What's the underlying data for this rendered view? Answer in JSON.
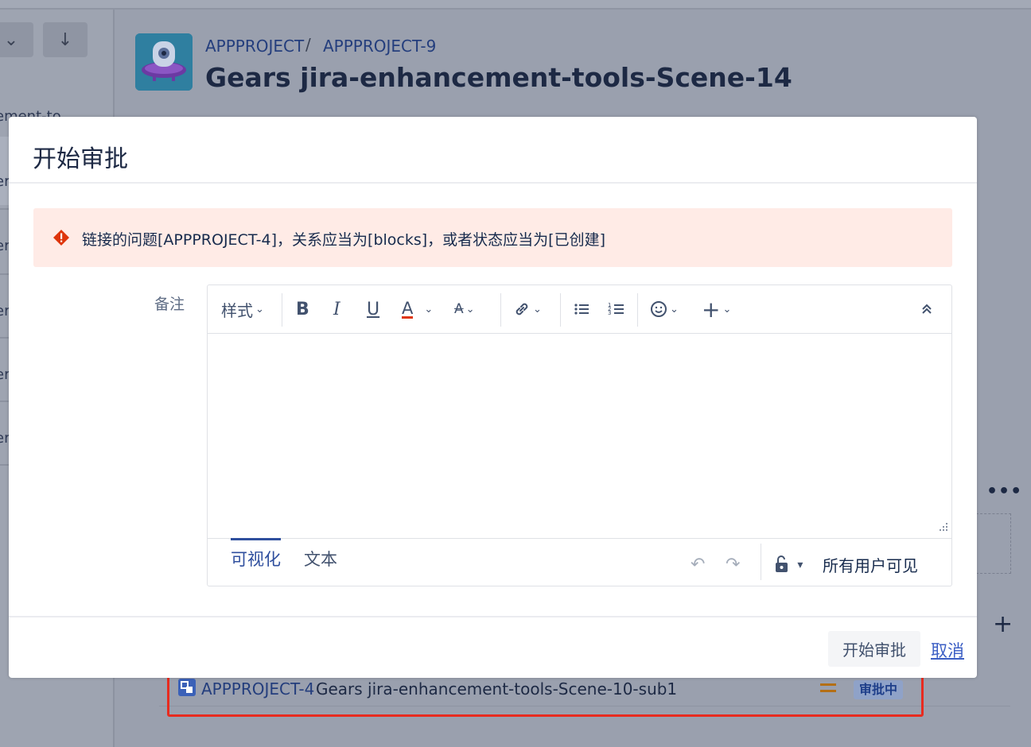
{
  "page": {
    "breadcrumb": {
      "project": "APPPROJECT",
      "separator": "/",
      "issue": "APPPROJECT-9"
    },
    "title": "Gears jira-enhancement-tools-Scene-14",
    "side_snippet": "ement-to",
    "side_letters": [
      "er",
      "er",
      "er",
      "er",
      "er"
    ]
  },
  "linked_issue": {
    "key": "APPPROJECT-4",
    "summary": "Gears jira-enhancement-tools-Scene-10-sub1",
    "status": "审批中",
    "priority_icon": "medium-priority-icon"
  },
  "dialog": {
    "title": "开始审批",
    "error_message": "链接的问题[APPPROJECT-4]，关系应当为[blocks]，或者状态应当为[已创建]",
    "note_label": "备注",
    "toolbar": {
      "style_label": "样式",
      "bold": "B",
      "italic": "I",
      "underline": "U",
      "text_color": "A",
      "more_format": "A",
      "plus": "+"
    },
    "tabs": {
      "visual": "可视化",
      "text": "文本"
    },
    "visibility": "所有用户可见",
    "submit_label": "开始审批",
    "cancel_label": "取消"
  },
  "colors": {
    "accent": "#2f4f9e",
    "error_bg": "#ffebe6",
    "error_icon": "#de350b",
    "highlight_border": "#e82b1f"
  }
}
